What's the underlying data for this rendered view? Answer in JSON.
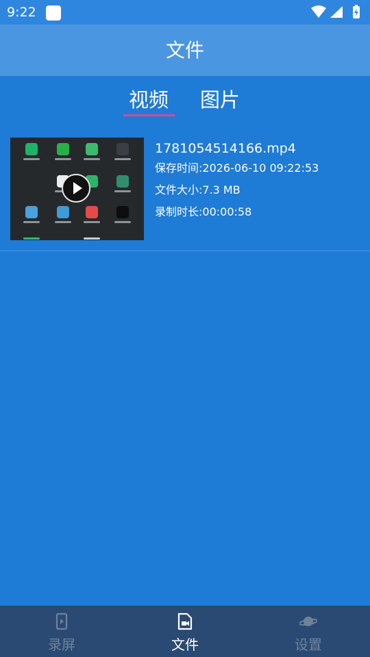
{
  "status_bar": {
    "time": "9:22"
  },
  "app_bar": {
    "title": "文件"
  },
  "tabs": [
    {
      "label": "视频",
      "active": true
    },
    {
      "label": "图片",
      "active": false
    }
  ],
  "files": [
    {
      "name": "1781054514166.mp4",
      "saved_time": "保存时间:2026-06-10 09:22:53",
      "file_size": "文件大小:7.3 MB",
      "duration": "录制时长:00:00:58"
    }
  ],
  "bottom_nav": [
    {
      "label": "录屏",
      "icon": "phone-record-icon",
      "active": false
    },
    {
      "label": "文件",
      "icon": "video-file-icon",
      "active": true
    },
    {
      "label": "设置",
      "icon": "planet-icon",
      "active": false
    }
  ],
  "colors": {
    "background": "#1e7bd6",
    "app_bar": "#4b96e0",
    "tab_indicator": "#e0449a",
    "bottom_nav": "#2a4a73"
  }
}
